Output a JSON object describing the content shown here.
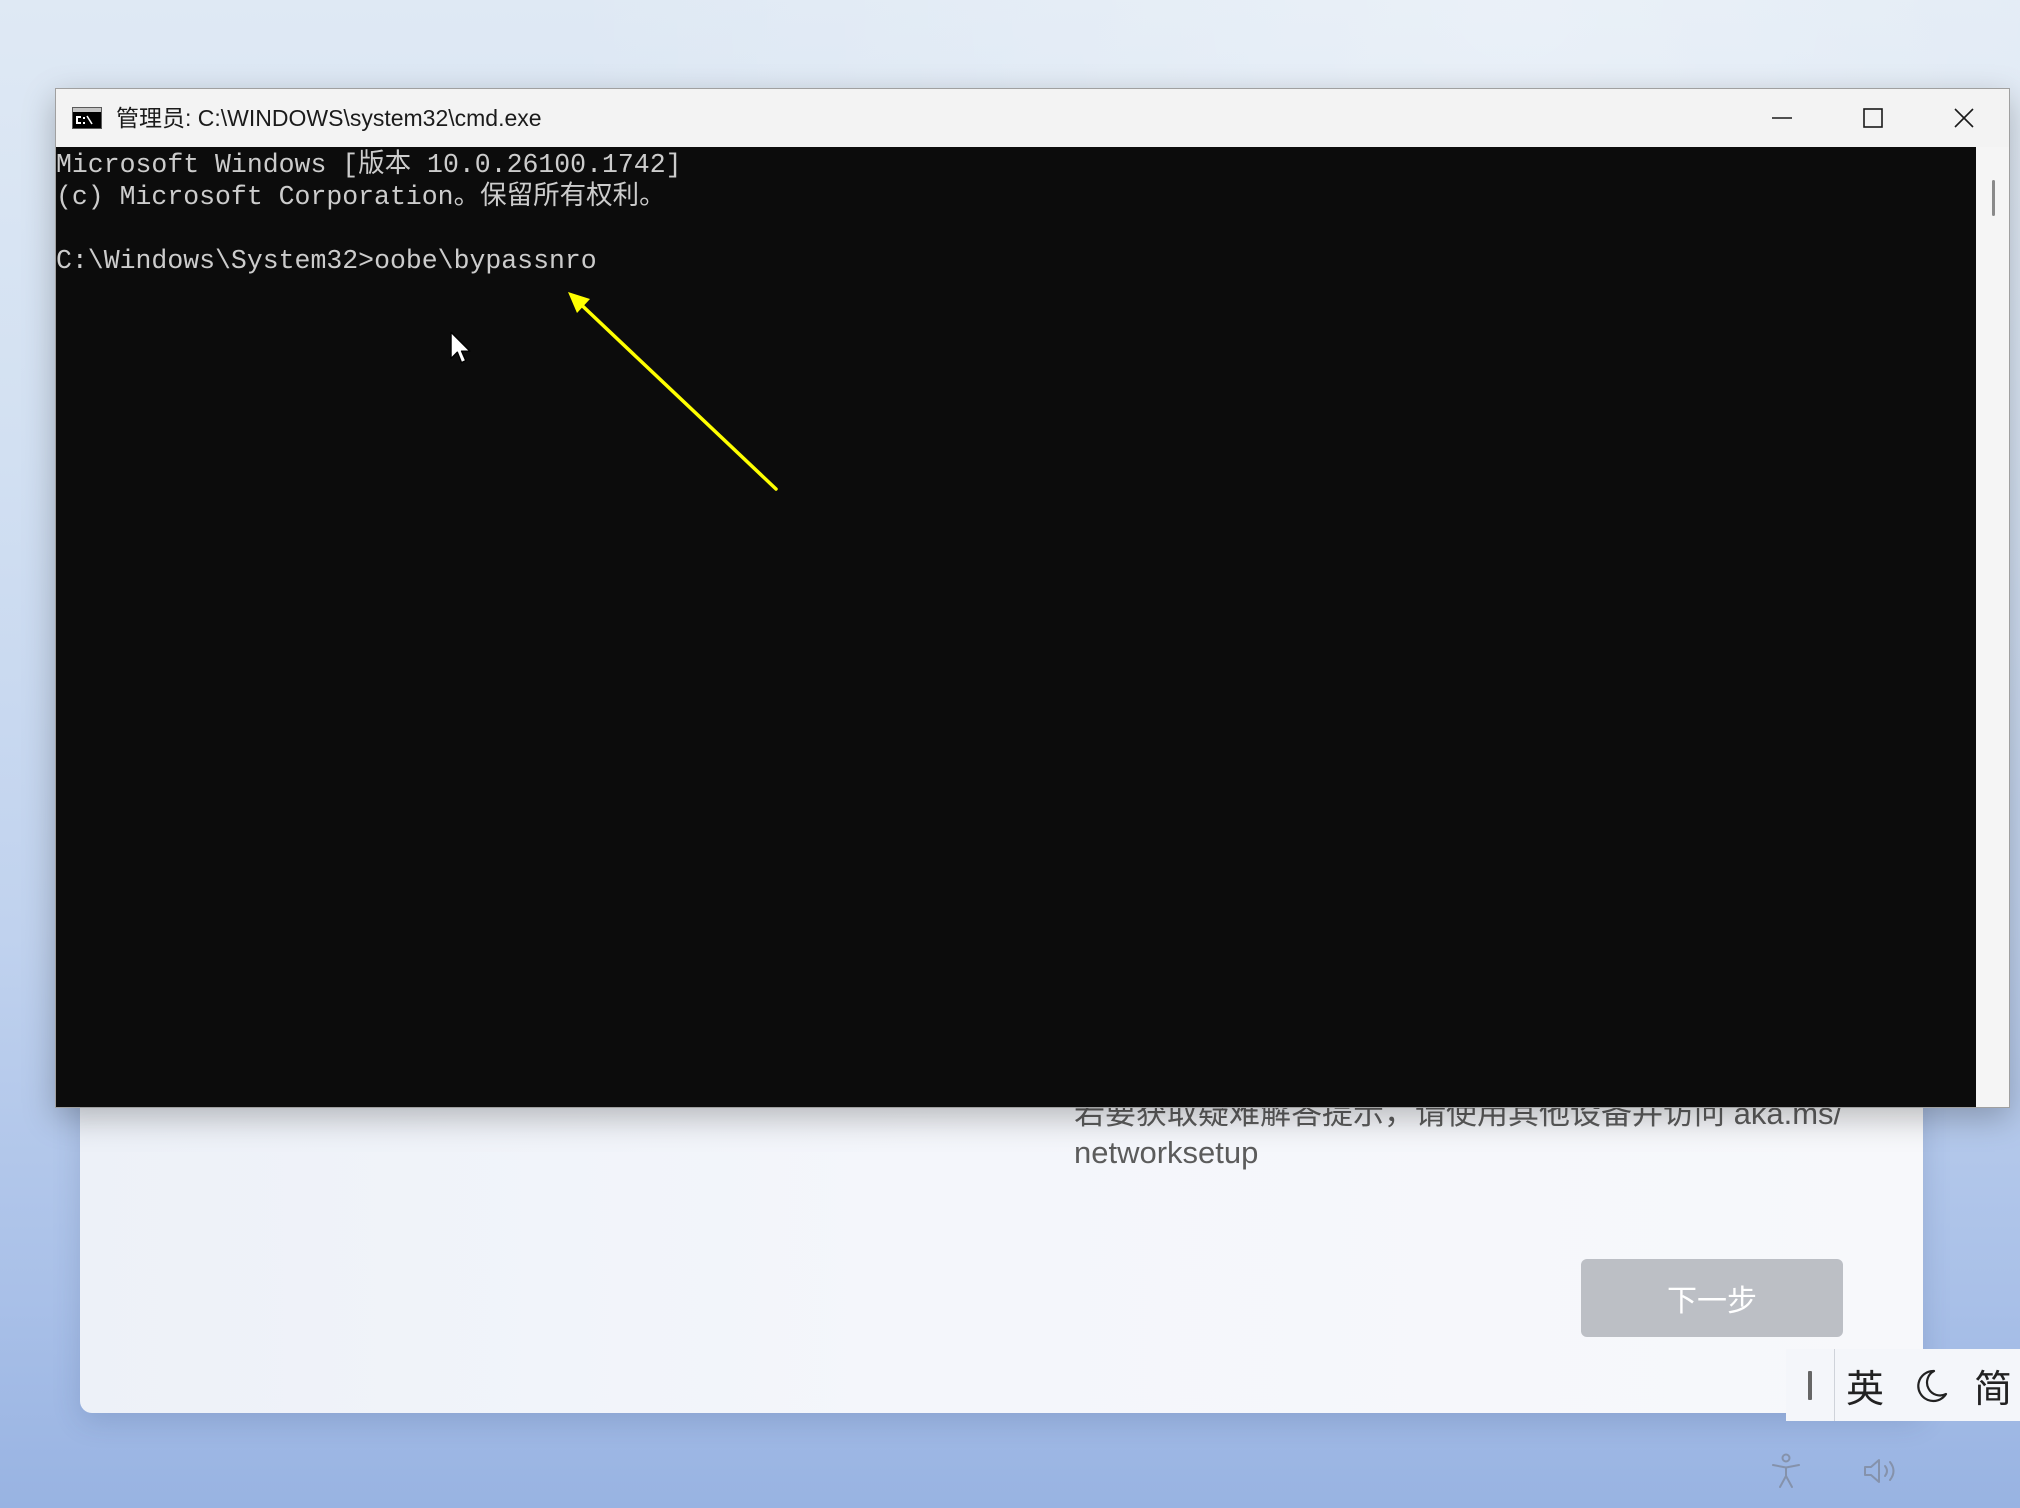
{
  "cmd_window": {
    "title": "管理员: C:\\WINDOWS\\system32\\cmd.exe",
    "icon": "cmd-icon",
    "controls": {
      "minimize": "minimize-icon",
      "maximize": "maximize-icon",
      "close": "close-icon"
    },
    "console": {
      "lines": [
        "Microsoft Windows [版本 10.0.26100.1742]",
        "(c) Microsoft Corporation。保留所有权利。"
      ],
      "prompt": "C:\\Windows\\System32>",
      "command": "oobe\\bypassnro"
    }
  },
  "oobe_dialog": {
    "help_text": [
      "若要获取疑难解答提示，请使用其他设备并访问 aka.ms/",
      "networksetup"
    ],
    "next_button": "下一步"
  },
  "ime_toolbar": {
    "mode": "英",
    "width_icon": "moon-icon",
    "script": "简"
  },
  "system_icons": [
    "accessibility-icon",
    "volume-icon"
  ],
  "colors": {
    "console_background": "#0c0c0c",
    "console_text": "#cccccc",
    "titlebar": "#f3f3f3",
    "next_button": "#bcbfc5",
    "help_text": "#5c5c5c",
    "annotation_arrow": "#ffff00"
  }
}
